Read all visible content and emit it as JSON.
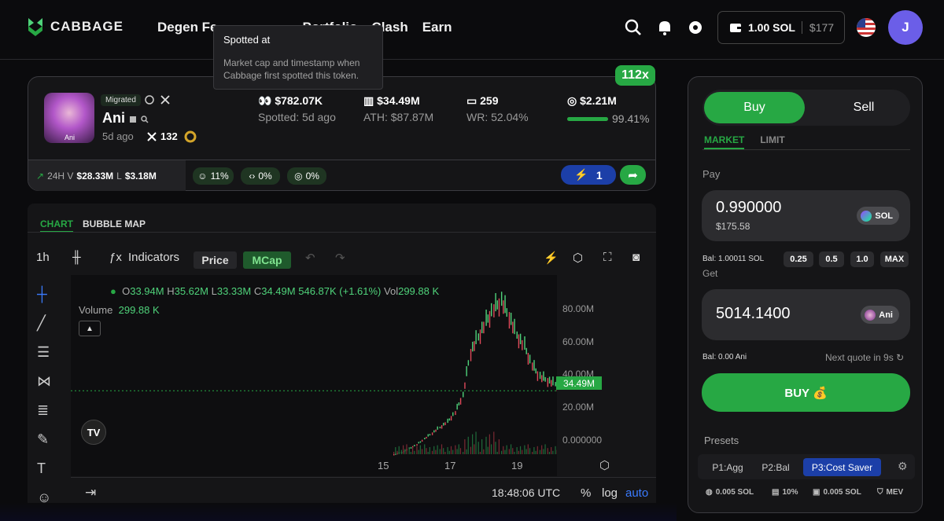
{
  "brand": {
    "name": "CABBAGE"
  },
  "nav": {
    "items": [
      "Degen Fe",
      "ed",
      "Portfolio",
      "Clash",
      "Earn"
    ]
  },
  "wallet": {
    "sol": "1.00 SOL",
    "usd": "$177"
  },
  "user": {
    "initial": "J"
  },
  "tooltip": {
    "title": "Spotted at",
    "body": "Market cap and timestamp when Cabbage first spotted this token."
  },
  "token": {
    "multiplier": "112x",
    "status": "Migrated",
    "name": "Ani",
    "image_label": "Ani",
    "age": "5d ago",
    "x_count": "132",
    "spotted_mcap": "$782.07K",
    "spotted_label": "Spotted: 5d ago",
    "mcap": "$34.49M",
    "ath": "ATH: $87.87M",
    "holders": "259",
    "winrate": "WR: 52.04%",
    "liquidity": "$2.21M",
    "liq_pct": "99.41%",
    "liq_fill": 0.9941,
    "vol_label": "24H V",
    "vol_value": "$28.33M",
    "l_label": "L",
    "l_value": "$3.18M",
    "pill1": "11%",
    "pill2": "0%",
    "pill3": "0%",
    "boost": "1"
  },
  "chart": {
    "tabs": [
      "CHART",
      "BUBBLE MAP"
    ],
    "interval": "1h",
    "indicators": "Indicators",
    "price_btn": "Price",
    "mcap_btn": "MCap",
    "ohlc": {
      "o_l": "O",
      "o": "33.94M",
      "h_l": "H",
      "h": "35.62M",
      "l_l": "L",
      "l": "33.33M",
      "c_l": "C",
      "c": "34.49M",
      "chg": "546.87K (+1.61%)",
      "vol_l": "Vol",
      "vol": "299.88 K"
    },
    "volume_label": "Volume",
    "volume_value": "299.88 K",
    "current": "34.49M",
    "time": "18:48:06 UTC",
    "pct": "%",
    "log": "log",
    "auto": "auto"
  },
  "chart_data": {
    "type": "line",
    "title": "",
    "xlabel": "",
    "ylabel": "",
    "x": [
      "15",
      "17",
      "19"
    ],
    "yticks": [
      "80.00M",
      "60.00M",
      "40.00M",
      "20.00M",
      "0.000000"
    ],
    "ylim": [
      0,
      90
    ],
    "series": [
      {
        "name": "",
        "values": [
          1,
          2,
          4,
          6,
          9,
          12,
          15,
          18,
          23,
          32,
          55,
          63,
          71,
          78,
          82,
          74,
          64,
          58,
          48,
          42,
          40,
          38,
          36,
          34.49
        ]
      }
    ],
    "grid": false
  },
  "trade": {
    "buy": "Buy",
    "sell": "Sell",
    "market": "MARKET",
    "limit": "LIMIT",
    "pay_label": "Pay",
    "pay_amount": "0.990000",
    "pay_usd": "$175.58",
    "pay_token": "SOL",
    "bal": "Bal: 1.00011 SOL",
    "pcts": [
      "0.25",
      "0.5",
      "1.0",
      "MAX"
    ],
    "get_label": "Get",
    "get_amount": "5014.1400",
    "get_token": "Ani",
    "get_bal": "Bal: 0.00 Ani",
    "next_quote": "Next quote in 9s",
    "buy_btn": "BUY 💰",
    "presets_label": "Presets",
    "presets": [
      "P1:Agg",
      "P2:Bal",
      "P3:Cost Saver"
    ],
    "info": [
      "0.005 SOL",
      "10%",
      "0.005 SOL",
      "MEV"
    ]
  },
  "colors": {
    "accent": "#27a844",
    "boost": "#1c3fa8",
    "avatar": "#6b5ee8"
  }
}
